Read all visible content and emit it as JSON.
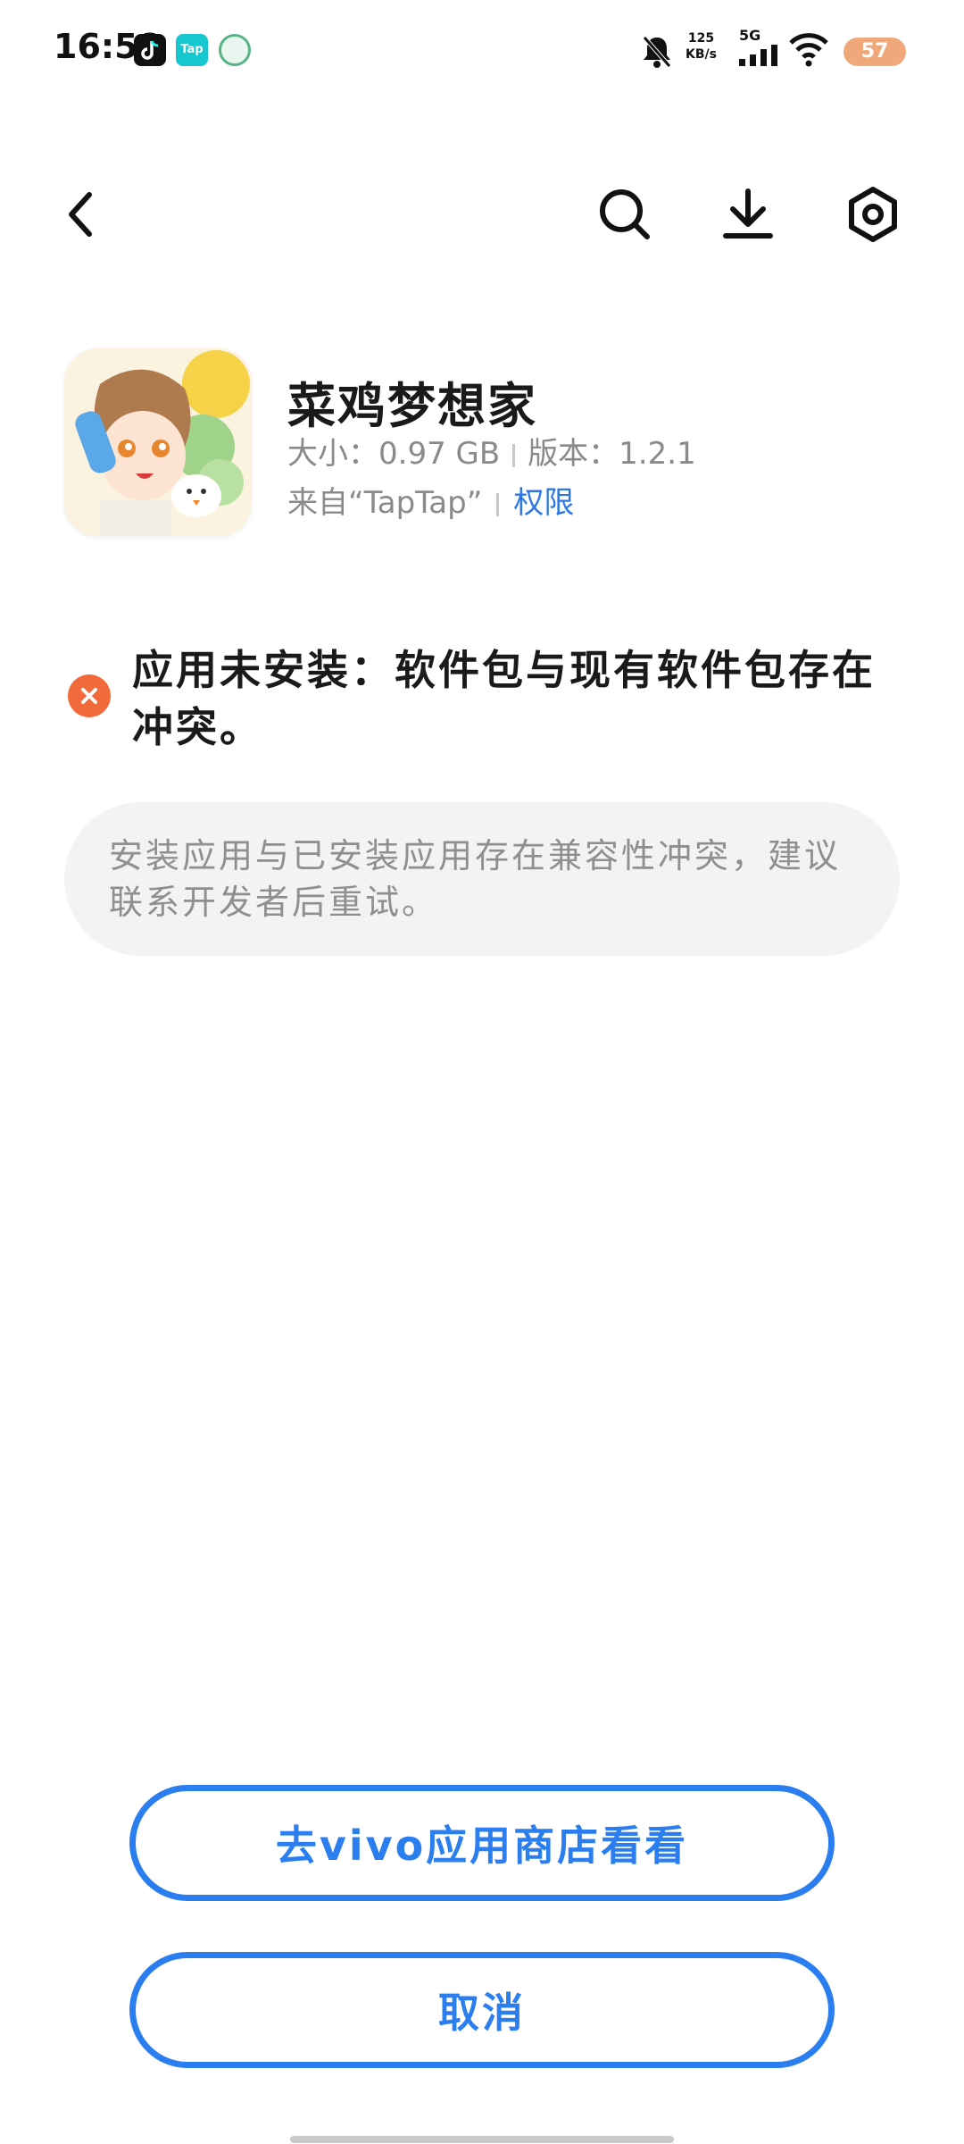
{
  "status_bar": {
    "time": "16:58",
    "tap_label": "Tap",
    "net_speed_value": "125",
    "net_speed_unit": "KB/s",
    "network_type": "5G",
    "battery_level": "57"
  },
  "app": {
    "name": "菜鸡梦想家",
    "size_label": "大小：0.97 GB",
    "version_label": "版本：1.2.1",
    "source_label": "来自“TapTap”",
    "permission_link": "权限"
  },
  "error": {
    "message": "应用未安装：软件包与现有软件包存在冲突。",
    "detail": "安装应用与已安装应用存在兼容性冲突，建议联系开发者后重试。"
  },
  "buttons": {
    "store_label": "去vivo应用商店看看",
    "cancel_label": "取消"
  },
  "colors": {
    "accent": "#2b7ef0",
    "error": "#f26a3b",
    "battery": "#f0a87a"
  }
}
